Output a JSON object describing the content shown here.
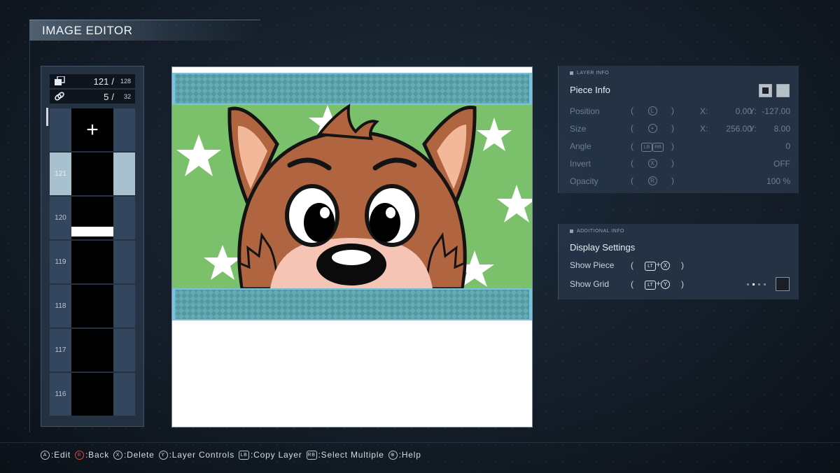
{
  "title": "IMAGE EDITOR",
  "counters": {
    "pieces": {
      "current": "121",
      "max": "128",
      "icon": "pieces-icon"
    },
    "layers": {
      "current": "5",
      "max": "32",
      "icon": "link-icon"
    }
  },
  "layers": {
    "add_label": "+",
    "rows": [
      {
        "number": "121",
        "selected": true
      },
      {
        "number": "120",
        "selected": false
      },
      {
        "number": "119",
        "selected": false
      },
      {
        "number": "118",
        "selected": false
      },
      {
        "number": "117",
        "selected": false
      },
      {
        "number": "116",
        "selected": false
      }
    ]
  },
  "layer_info": {
    "header": "LAYER INFO",
    "title": "Piece Info",
    "position": {
      "label": "Position",
      "button": "L",
      "x_label": "X:",
      "x": "0.00",
      "y_label": "Y:",
      "y": "-127.00"
    },
    "size": {
      "label": "Size",
      "button": "+",
      "x_label": "X:",
      "x": "256.00",
      "y_label": "Y:",
      "y": "8.00"
    },
    "angle": {
      "label": "Angle",
      "button_a": "LB",
      "button_b": "RB",
      "value": "0"
    },
    "invert": {
      "label": "Invert",
      "button": "X",
      "value": "OFF"
    },
    "opacity": {
      "label": "Opacity",
      "button": "R",
      "value": "100 %"
    },
    "swatch_colors": [
      "#1c2128",
      "#b7bfc7"
    ]
  },
  "additional_info": {
    "header": "ADDITIONAL INFO",
    "title": "Display Settings",
    "show_piece": {
      "label": "Show Piece",
      "button_a": "LT",
      "plus": "+",
      "button_b": "X"
    },
    "show_grid": {
      "label": "Show Grid",
      "button_a": "LT",
      "plus": "+",
      "button_b": "Y"
    }
  },
  "help": [
    {
      "button": "A",
      "label": ":Edit"
    },
    {
      "button": "B",
      "label": ":Back"
    },
    {
      "button": "X",
      "label": ":Delete"
    },
    {
      "button": "Y",
      "label": ":Layer Controls"
    },
    {
      "button": "LB",
      "label": ":Copy Layer"
    },
    {
      "button": "RB",
      "label": ":Select Multiple"
    },
    {
      "button": "⊕",
      "label": ":Help"
    }
  ],
  "colors": {
    "canvas_green": "#7bc16b",
    "canvas_teal": "#5ba6ac",
    "canvas_blue": "#79c2de",
    "fox_brown": "#b0643f",
    "fox_pink": "#f6c4b4"
  }
}
